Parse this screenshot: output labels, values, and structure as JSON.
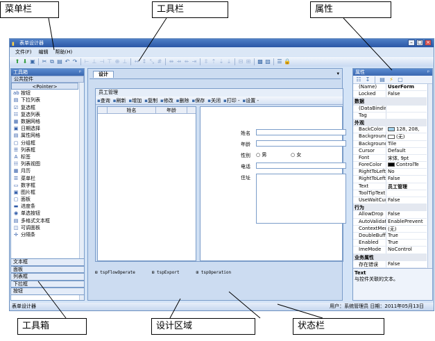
{
  "callouts": {
    "menubar": "菜单栏",
    "toolbar": "工具栏",
    "properties": "属性",
    "toolbox": "工具箱",
    "design_area": "设计区域",
    "statusbar": "状态栏"
  },
  "window": {
    "title": "表单设计器"
  },
  "menu": [
    "文件(F)",
    "编辑",
    "帮助(H)"
  ],
  "toolbox": {
    "title": "工具箱",
    "pin": "ᵖ",
    "category": "公共控件",
    "pointer": "<Pointer>",
    "items": [
      {
        "label": "按钮",
        "icon": "ab"
      },
      {
        "label": "下拉列表",
        "icon": "▤"
      },
      {
        "label": "复选框",
        "icon": "☑"
      },
      {
        "label": "复选列表",
        "icon": "☷"
      },
      {
        "label": "数据网格",
        "icon": "▦"
      },
      {
        "label": "日期选择",
        "icon": "▣"
      },
      {
        "label": "属性网格",
        "icon": "▤"
      },
      {
        "label": "分组框",
        "icon": "▢"
      },
      {
        "label": "列表框",
        "icon": "☰"
      },
      {
        "label": "标签",
        "icon": "A"
      },
      {
        "label": "列表视图",
        "icon": "☷"
      },
      {
        "label": "月历",
        "icon": "▦"
      },
      {
        "label": "菜单栏",
        "icon": "☰"
      },
      {
        "label": "数字框",
        "icon": "▭"
      },
      {
        "label": "图片框",
        "icon": "▣"
      },
      {
        "label": "面板",
        "icon": "▢"
      },
      {
        "label": "进度条",
        "icon": "▬"
      },
      {
        "label": "单选按钮",
        "icon": "◉"
      },
      {
        "label": "多格式文本框",
        "icon": "▤"
      },
      {
        "label": "可调面板",
        "icon": "◫"
      },
      {
        "label": "分隔条",
        "icon": "✢"
      }
    ],
    "bottom_tabs": [
      "文本框",
      "面板",
      "列表框",
      "下拉框",
      "按钮"
    ]
  },
  "design": {
    "tab": "设计",
    "form_title": "员工管理",
    "form_tools": [
      "查询",
      "刷新",
      "增加",
      "复制",
      "修改",
      "删除",
      "保存",
      "关闭",
      "打印 -",
      "设置 -"
    ],
    "grid_columns": [
      "姓名",
      "年龄"
    ],
    "fields": {
      "name": "姓名",
      "age": "年龄",
      "gender": "性别",
      "male": "男",
      "female": "女",
      "phone": "电话",
      "address": "住址"
    },
    "tray": [
      "tspFlowOperate",
      "tspExport",
      "tspOperation"
    ]
  },
  "properties": {
    "title": "属性",
    "pin": "ᵖ",
    "rows": [
      {
        "name": "(Name)",
        "value": "UserForm",
        "bold": true
      },
      {
        "name": "Locked",
        "value": "False"
      },
      {
        "name": "数据",
        "value": "",
        "cat": true
      },
      {
        "name": "(DataBindin",
        "value": ""
      },
      {
        "name": "Tag",
        "value": ""
      },
      {
        "name": "外观",
        "value": "",
        "cat": true
      },
      {
        "name": "BackColor",
        "value": "128, 208,",
        "swatch": "#9fd0ea"
      },
      {
        "name": "BackgroundI",
        "value": "(无)",
        "swatch": "#ffffff"
      },
      {
        "name": "BackgroundI",
        "value": "Tile"
      },
      {
        "name": "Cursor",
        "value": "Default"
      },
      {
        "name": "Font",
        "value": "宋体, 9pt"
      },
      {
        "name": "ForeColor",
        "value": "ControlTe",
        "swatch": "#000000"
      },
      {
        "name": "RightToLeft",
        "value": "No"
      },
      {
        "name": "RightToLeft",
        "value": "False"
      },
      {
        "name": "Text",
        "value": "员工管理",
        "bold": true
      },
      {
        "name": "ToolTipText",
        "value": ""
      },
      {
        "name": "UseWaitCurs",
        "value": "False"
      },
      {
        "name": "行为",
        "value": "",
        "cat": true
      },
      {
        "name": "AllowDrop",
        "value": "False"
      },
      {
        "name": "AutoValidat",
        "value": "EnablePrevent"
      },
      {
        "name": "ContextMenu",
        "value": "(无)"
      },
      {
        "name": "DoubleBuffe",
        "value": "True"
      },
      {
        "name": "Enabled",
        "value": "True"
      },
      {
        "name": "ImeMode",
        "value": "NoControl"
      },
      {
        "name": "业务属性",
        "value": "",
        "cat": true
      },
      {
        "name": "存在错误",
        "value": "False"
      }
    ],
    "desc_title": "Text",
    "desc_text": "与控件关联的文本。"
  },
  "status": {
    "left": "表单设计器",
    "right": "用户：系统管理员  日期：2011年05月13日"
  }
}
